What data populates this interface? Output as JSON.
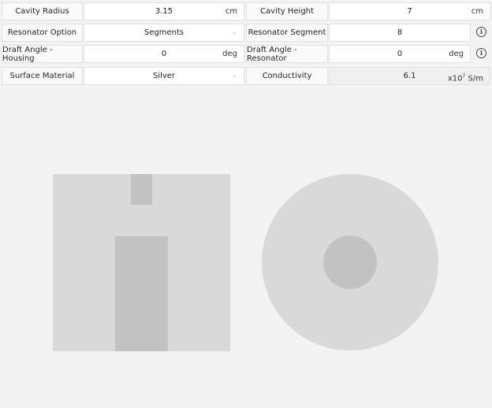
{
  "rows": [
    {
      "label": "Cavity Radius",
      "value": "3.15",
      "unit": "cm",
      "label2": "Cavity Height",
      "value2": "7",
      "unit2": "cm"
    },
    {
      "label": "Resonator Option",
      "value": "Segments",
      "label2": "Resonator Segment",
      "value2": "8"
    },
    {
      "label": "Draft Angle - Housing",
      "value": "0",
      "unit": "deg",
      "label2": "Draft Angle - Resonator",
      "value2": "0",
      "unit2": "deg"
    },
    {
      "label": "Surface Material",
      "value": "Silver",
      "label2": "Conductivity",
      "value2": "6.1",
      "unit2_base": "x10",
      "unit2_exp": "7",
      "unit2_suffix": " S/m"
    }
  ],
  "icons": {
    "dropdown": "chevron-down-icon",
    "info": "info-icon"
  },
  "colors": {
    "background": "#f3f3f3",
    "shape_outer": "#d9d9d9",
    "shape_inner": "#c2c2c2"
  }
}
